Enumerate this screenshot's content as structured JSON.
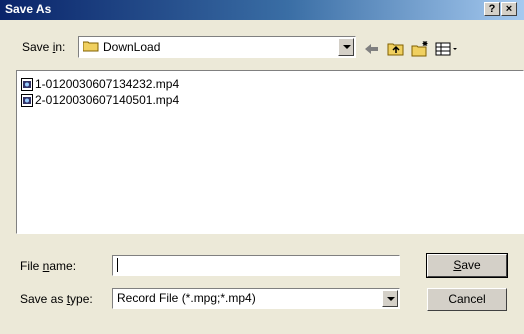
{
  "window": {
    "title": "Save As",
    "help_label": "?",
    "close_label": "×"
  },
  "save_in": {
    "label_pre": "Save ",
    "label_u": "i",
    "label_post": "n:",
    "folder": "DownLoad"
  },
  "files": [
    {
      "name": "1-0120030607134232.mp4"
    },
    {
      "name": "2-0120030607140501.mp4"
    }
  ],
  "file_name": {
    "label_pre": "File ",
    "label_u": "n",
    "label_post": "ame:",
    "value": ""
  },
  "save_as_type": {
    "label_pre": "Save as ",
    "label_u": "t",
    "label_post": "ype:",
    "value": "Record File (*.mpg;*.mp4)"
  },
  "buttons": {
    "save_u": "S",
    "save_post": "ave",
    "cancel": "Cancel"
  },
  "icons": {
    "back": "back-arrow-icon",
    "up": "up-folder-icon",
    "new": "new-folder-icon",
    "view": "view-menu-icon"
  }
}
